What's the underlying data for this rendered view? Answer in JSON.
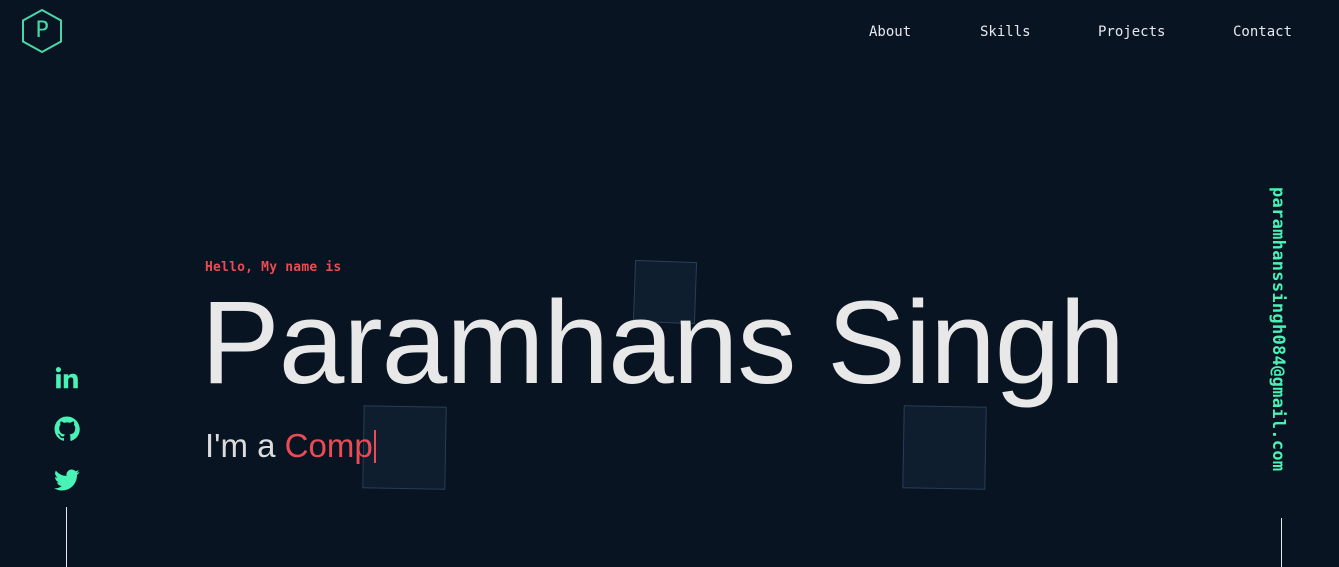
{
  "logo": {
    "letter": "P",
    "icon": "hexagon-logo-icon",
    "color": "#49d7a8"
  },
  "nav": {
    "items": [
      {
        "label": "About"
      },
      {
        "label": "Skills"
      },
      {
        "label": "Projects"
      },
      {
        "label": "Contact"
      }
    ]
  },
  "hero": {
    "greeting": "Hello, My name is",
    "name": "Paramhans Singh",
    "role_prefix": "I'm a ",
    "role_typed": "Comp"
  },
  "social": {
    "items": [
      {
        "icon": "linkedin-icon"
      },
      {
        "icon": "github-icon"
      },
      {
        "icon": "twitter-icon"
      }
    ]
  },
  "email": "paramhanssingh084@gmail.com",
  "colors": {
    "background": "#081421",
    "accent_green": "#49f2b5",
    "accent_red": "#ea4b54",
    "text_light": "#e8e8e8"
  }
}
